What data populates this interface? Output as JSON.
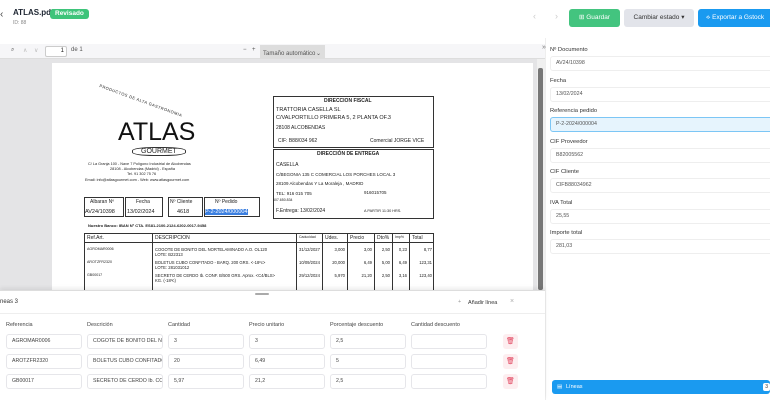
{
  "header": {
    "title": "ATLAS.pdf",
    "status": "Revisado",
    "id": "ID: 88",
    "save": "Guardar",
    "change_state": "Cambiar estado",
    "export": "Exportar a Gstock"
  },
  "colors": {
    "success": "#3ec47a",
    "primary": "#1a9af0"
  },
  "toolbar": {
    "page": "1",
    "of": "de 1",
    "zoom": "Tamaño automático"
  },
  "document": {
    "slogan": "PRODUCTOS DE ALTA GASTRONOMIA",
    "brand": "ATLAS",
    "brand_sub": "GOURMET",
    "addr1": "C/ La Granja 100 - Nave 7 Polígono Industrial de Alcobendas",
    "addr2": "28108 - Alcobendas (Madrid) - España",
    "addr3": "Tel. 91 302 75 76",
    "addr4": "Email: info@atlasgourmet.com - Web: www.atlasgourmet.com",
    "h_albaran": "Albaran Nº",
    "h_fecha": "Fecha",
    "h_cliente": "Nº Cliente",
    "h_pedido": "Nº Pedido",
    "v_albaran": "AV24/10398",
    "v_fecha": "13/02/2024",
    "v_cliente": "4618",
    "v_pedido": "P-2-2024/000004",
    "bank": "Nuestro Banco:   IBAN Nº CTA. ES81-2100-2124-6202-0017-9458",
    "fiscal_title": "DIRECCION FISCAL",
    "fiscal1": "TRATTORIA CASELLA SL",
    "fiscal2": "C/VALPORTILLO PRIMERA 5, 2 PLANTA OF.3",
    "fiscal3": "28108     ALCOBENDAS",
    "fiscal4": "CIF: B88/034 962",
    "comercial": "Comercial    JORGE VICE",
    "entrega_title": "DIRECCIÓN DE ENTREGA",
    "entrega1": "CASELLA",
    "entrega2": "C/BEGONIA 135 C COMERCIAL LOS PORCHES LOCAL 3",
    "entrega3": "28109   Alcobendas Y La Moraleja , MADRID",
    "entrega4": "TEL:     916 015 705",
    "entrega4b": "916015705",
    "entrega5": "607.650.834",
    "entrega6": "F.Entrega:     13/02/2024",
    "entrega6b": "A PARTIR 11:30 HRS.",
    "cols": [
      "Ref.Art.",
      "DESCRIPCION",
      "Caducidad",
      "Udes.",
      "Precio",
      "Dto%",
      "Imp%",
      "Total"
    ],
    "rows": [
      [
        "AGROMAR0006",
        "COGOTE DE BONITO DEL NORTELAMINADO A.O. OL120",
        "31/12/2027",
        "3,000",
        "3,00",
        "2,50",
        "0,23",
        "8,77"
      ],
      [
        "AROTZFR2320",
        "BOLETUS CUBO CONFITADO - BARQ. 200 GRS. <-18ºc>",
        "10/09/2024",
        "20,000",
        "6,49",
        "5,00",
        "6,49",
        "123,31"
      ],
      [
        "GB00017",
        "SECRETO DE CERDO Ib. CONF. B/500 GRS. Aprox. <C4/BLS>",
        "29/12/2024",
        "5,970",
        "21,20",
        "2,50",
        "3,16",
        "123,40"
      ]
    ],
    "lote1": "LOTE: B22313",
    "lote2": "LOTE: 281031012",
    "lote3": "KG. (-18ºc)"
  },
  "fields": [
    {
      "label": "Nº Documento",
      "value": "AV24/10398"
    },
    {
      "label": "Fecha",
      "value": "13/02/2024"
    },
    {
      "label": "Referencia pedido",
      "value": "P-2-2024/000004"
    },
    {
      "label": "CIF Proveedor",
      "value": "B82005562"
    },
    {
      "label": "CIF Cliente",
      "value": "CIFB88034962"
    },
    {
      "label": "IVA Total",
      "value": "25,55"
    },
    {
      "label": "Importe total",
      "value": "281,03"
    }
  ],
  "lines": {
    "title": "neas  3",
    "add": "Añadir línea",
    "columns": [
      "Referencia",
      "Descrición",
      "Cantidad",
      "Precio unitario",
      "Porcentaje descuento",
      "Cantidad descuento"
    ],
    "rows": [
      [
        "AGROMAR0006",
        "COGOTE DE BONITO DEL NO",
        "3",
        "3",
        "2,5",
        ""
      ],
      [
        "AROTZFR2320",
        "BOLETUS CUBO CONFITADO",
        "20",
        "6,49",
        "5",
        ""
      ],
      [
        "GB00017",
        "SECRETO DE CERDO Ib. CON",
        "5,97",
        "21,2",
        "2,5",
        ""
      ]
    ]
  },
  "lines_button": {
    "label": "Líneas",
    "count": "3"
  }
}
